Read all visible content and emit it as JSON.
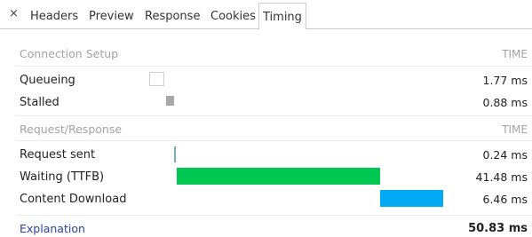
{
  "tabs": {
    "close_symbol": "×",
    "items": [
      "Headers",
      "Preview",
      "Response",
      "Cookies",
      "Timing"
    ],
    "active": "Timing"
  },
  "connection_setup": {
    "title": "Connection Setup",
    "time_header": "TIME",
    "rows": [
      {
        "label": "Queueing",
        "value": "1.77 ms"
      },
      {
        "label": "Stalled",
        "value": "0.88 ms"
      }
    ]
  },
  "request_response": {
    "title": "Request/Response",
    "time_header": "TIME",
    "rows": [
      {
        "label": "Request sent",
        "value": "0.24 ms"
      },
      {
        "label": "Waiting (TTFB)",
        "value": "41.48 ms"
      },
      {
        "label": "Content Download",
        "value": "6.46 ms"
      }
    ]
  },
  "footer": {
    "explanation": "Explanation",
    "total": "50.83 ms"
  },
  "colors": {
    "queueing": "#ffffff",
    "stalled": "#a8a8a8",
    "request_sent": "#7eabb8",
    "waiting": "#00c853",
    "download": "#03a9f4",
    "link": "#2a3fa0"
  }
}
